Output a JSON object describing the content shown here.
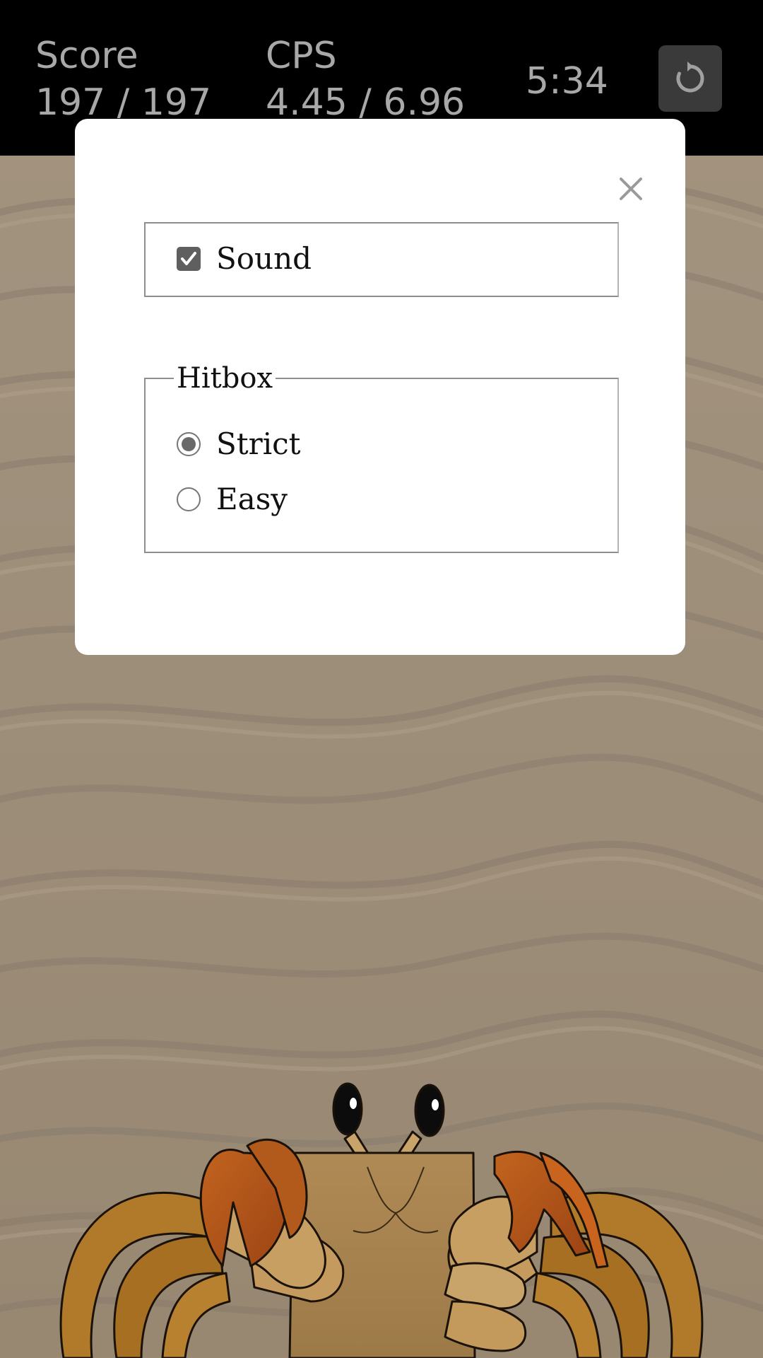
{
  "topbar": {
    "score_label": "Score",
    "score_value": "197 / 197",
    "cps_label": "CPS",
    "cps_value": "4.45 / 6.96",
    "timer": "5:34",
    "restart_icon": "restart-icon"
  },
  "settings": {
    "close_icon": "close-icon",
    "sound_label": "Sound",
    "sound_checked": true,
    "hitbox_legend": "Hitbox",
    "hitbox_options": [
      {
        "label": "Strict",
        "selected": true
      },
      {
        "label": "Easy",
        "selected": false
      }
    ]
  },
  "colors": {
    "topbar_bg": "#000000",
    "stat_text": "#a8a8a8",
    "sand": "#9e8f7b",
    "modal_bg": "#ffffff",
    "crab_shell": "#a8824f",
    "crab_claw": "#b8531c",
    "crab_legs": "#b07a2a"
  }
}
